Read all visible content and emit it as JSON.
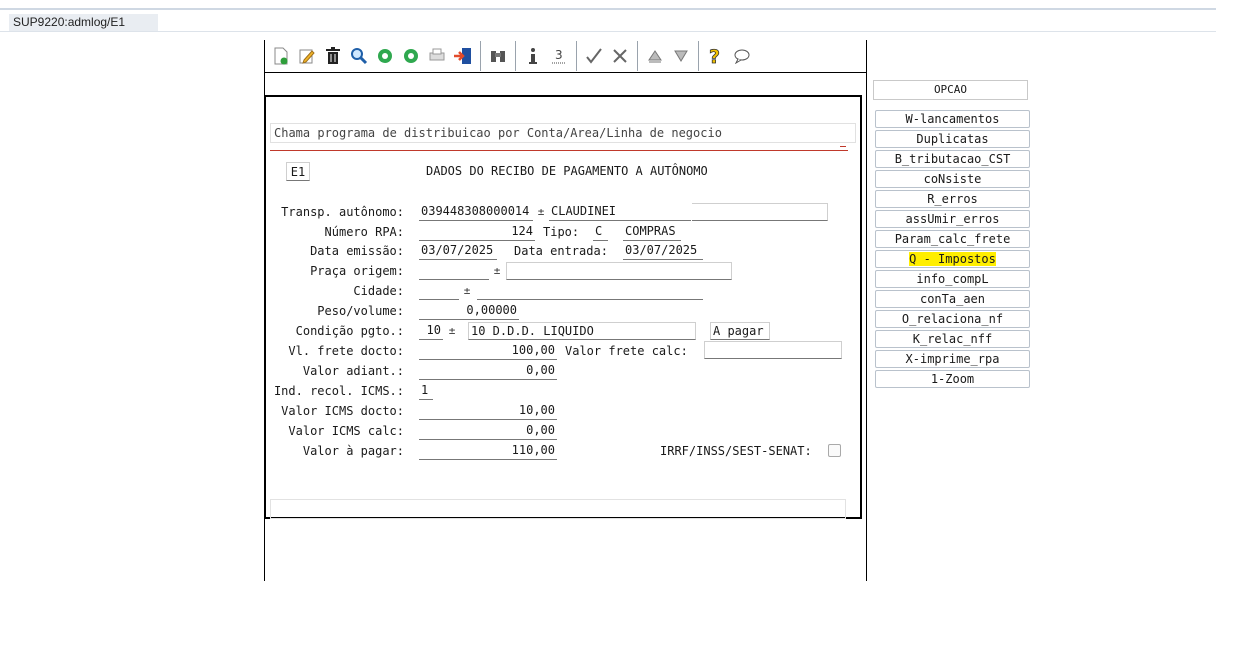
{
  "window": {
    "tab_title": "SUP9220:admlog/E1"
  },
  "toolbar": {
    "icons": [
      "new-doc-icon",
      "edit-icon",
      "delete-icon",
      "search-icon",
      "prev-record-icon",
      "next-record-icon",
      "print-icon",
      "exit-icon",
      "binoculars-icon",
      "info-icon",
      "list-icon",
      "confirm-icon",
      "cancel-icon",
      "sort-up-icon",
      "filter-icon",
      "help-icon",
      "chat-icon"
    ]
  },
  "message_bar": {
    "text": "Chama programa de distribuicao por Conta/Area/Linha de negocio"
  },
  "form": {
    "code": "E1",
    "title": "DADOS DO RECIBO DE PAGAMENTO A AUTÔNOMO",
    "labels": {
      "transp": "Transp. autônomo:",
      "numero_rpa": "Número RPA:",
      "tipo": "Tipo:",
      "data_emissao": "Data emissão:",
      "data_entrada": "Data entrada:",
      "praca_origem": "Praça origem:",
      "cidade": "Cidade:",
      "peso_volume": "Peso/volume:",
      "condicao_pgto": "Condição pgto.:",
      "vl_frete_docto": "Vl. frete docto:",
      "valor_frete_calc": "Valor frete calc:",
      "valor_adiant": "Valor adiant.:",
      "ind_recol_icms": "Ind. recol. ICMS.:",
      "valor_icms_docto": "Valor ICMS docto:",
      "valor_icms_calc": "Valor ICMS calc:",
      "valor_a_pagar": "Valor à pagar:",
      "irrf": "IRRF/INSS/SEST-SENAT:"
    },
    "values": {
      "transp_code": "039448308000014",
      "transp_name": "CLAUDINEI",
      "numero_rpa": "124",
      "tipo": "C",
      "tipo_desc": "COMPRAS",
      "data_emissao": "03/07/2025",
      "data_entrada": "03/07/2025",
      "praca_origem": "",
      "praca_origem_desc": "",
      "cidade": "",
      "cidade_desc": "",
      "peso_volume": "0,00000",
      "condicao_code": "10",
      "condicao_desc": "10 D.D.D. LIQUIDO",
      "condicao_status": "A pagar",
      "vl_frete_docto": "100,00",
      "valor_frete_calc": "",
      "valor_adiant": "0,00",
      "ind_recol_icms": "1",
      "valor_icms_docto": "10,00",
      "valor_icms_calc": "0,00",
      "valor_a_pagar": "110,00"
    },
    "dropdown_glyph": "±"
  },
  "options": {
    "header": "OPCAO",
    "items": [
      "W-lancamentos",
      "Duplicatas",
      "B_tributacao_CST",
      "coNsiste",
      "R_erros",
      "assUmir_erros",
      "Param_calc_frete",
      "Q - Impostos",
      "info_compL",
      "conTa_aen",
      "O_relaciona_nf",
      "K_relac_nff",
      "X-imprime_rpa",
      "1-Zoom"
    ]
  },
  "colors": {
    "highlight": "#ffee00",
    "accent_red": "#c0392b"
  }
}
